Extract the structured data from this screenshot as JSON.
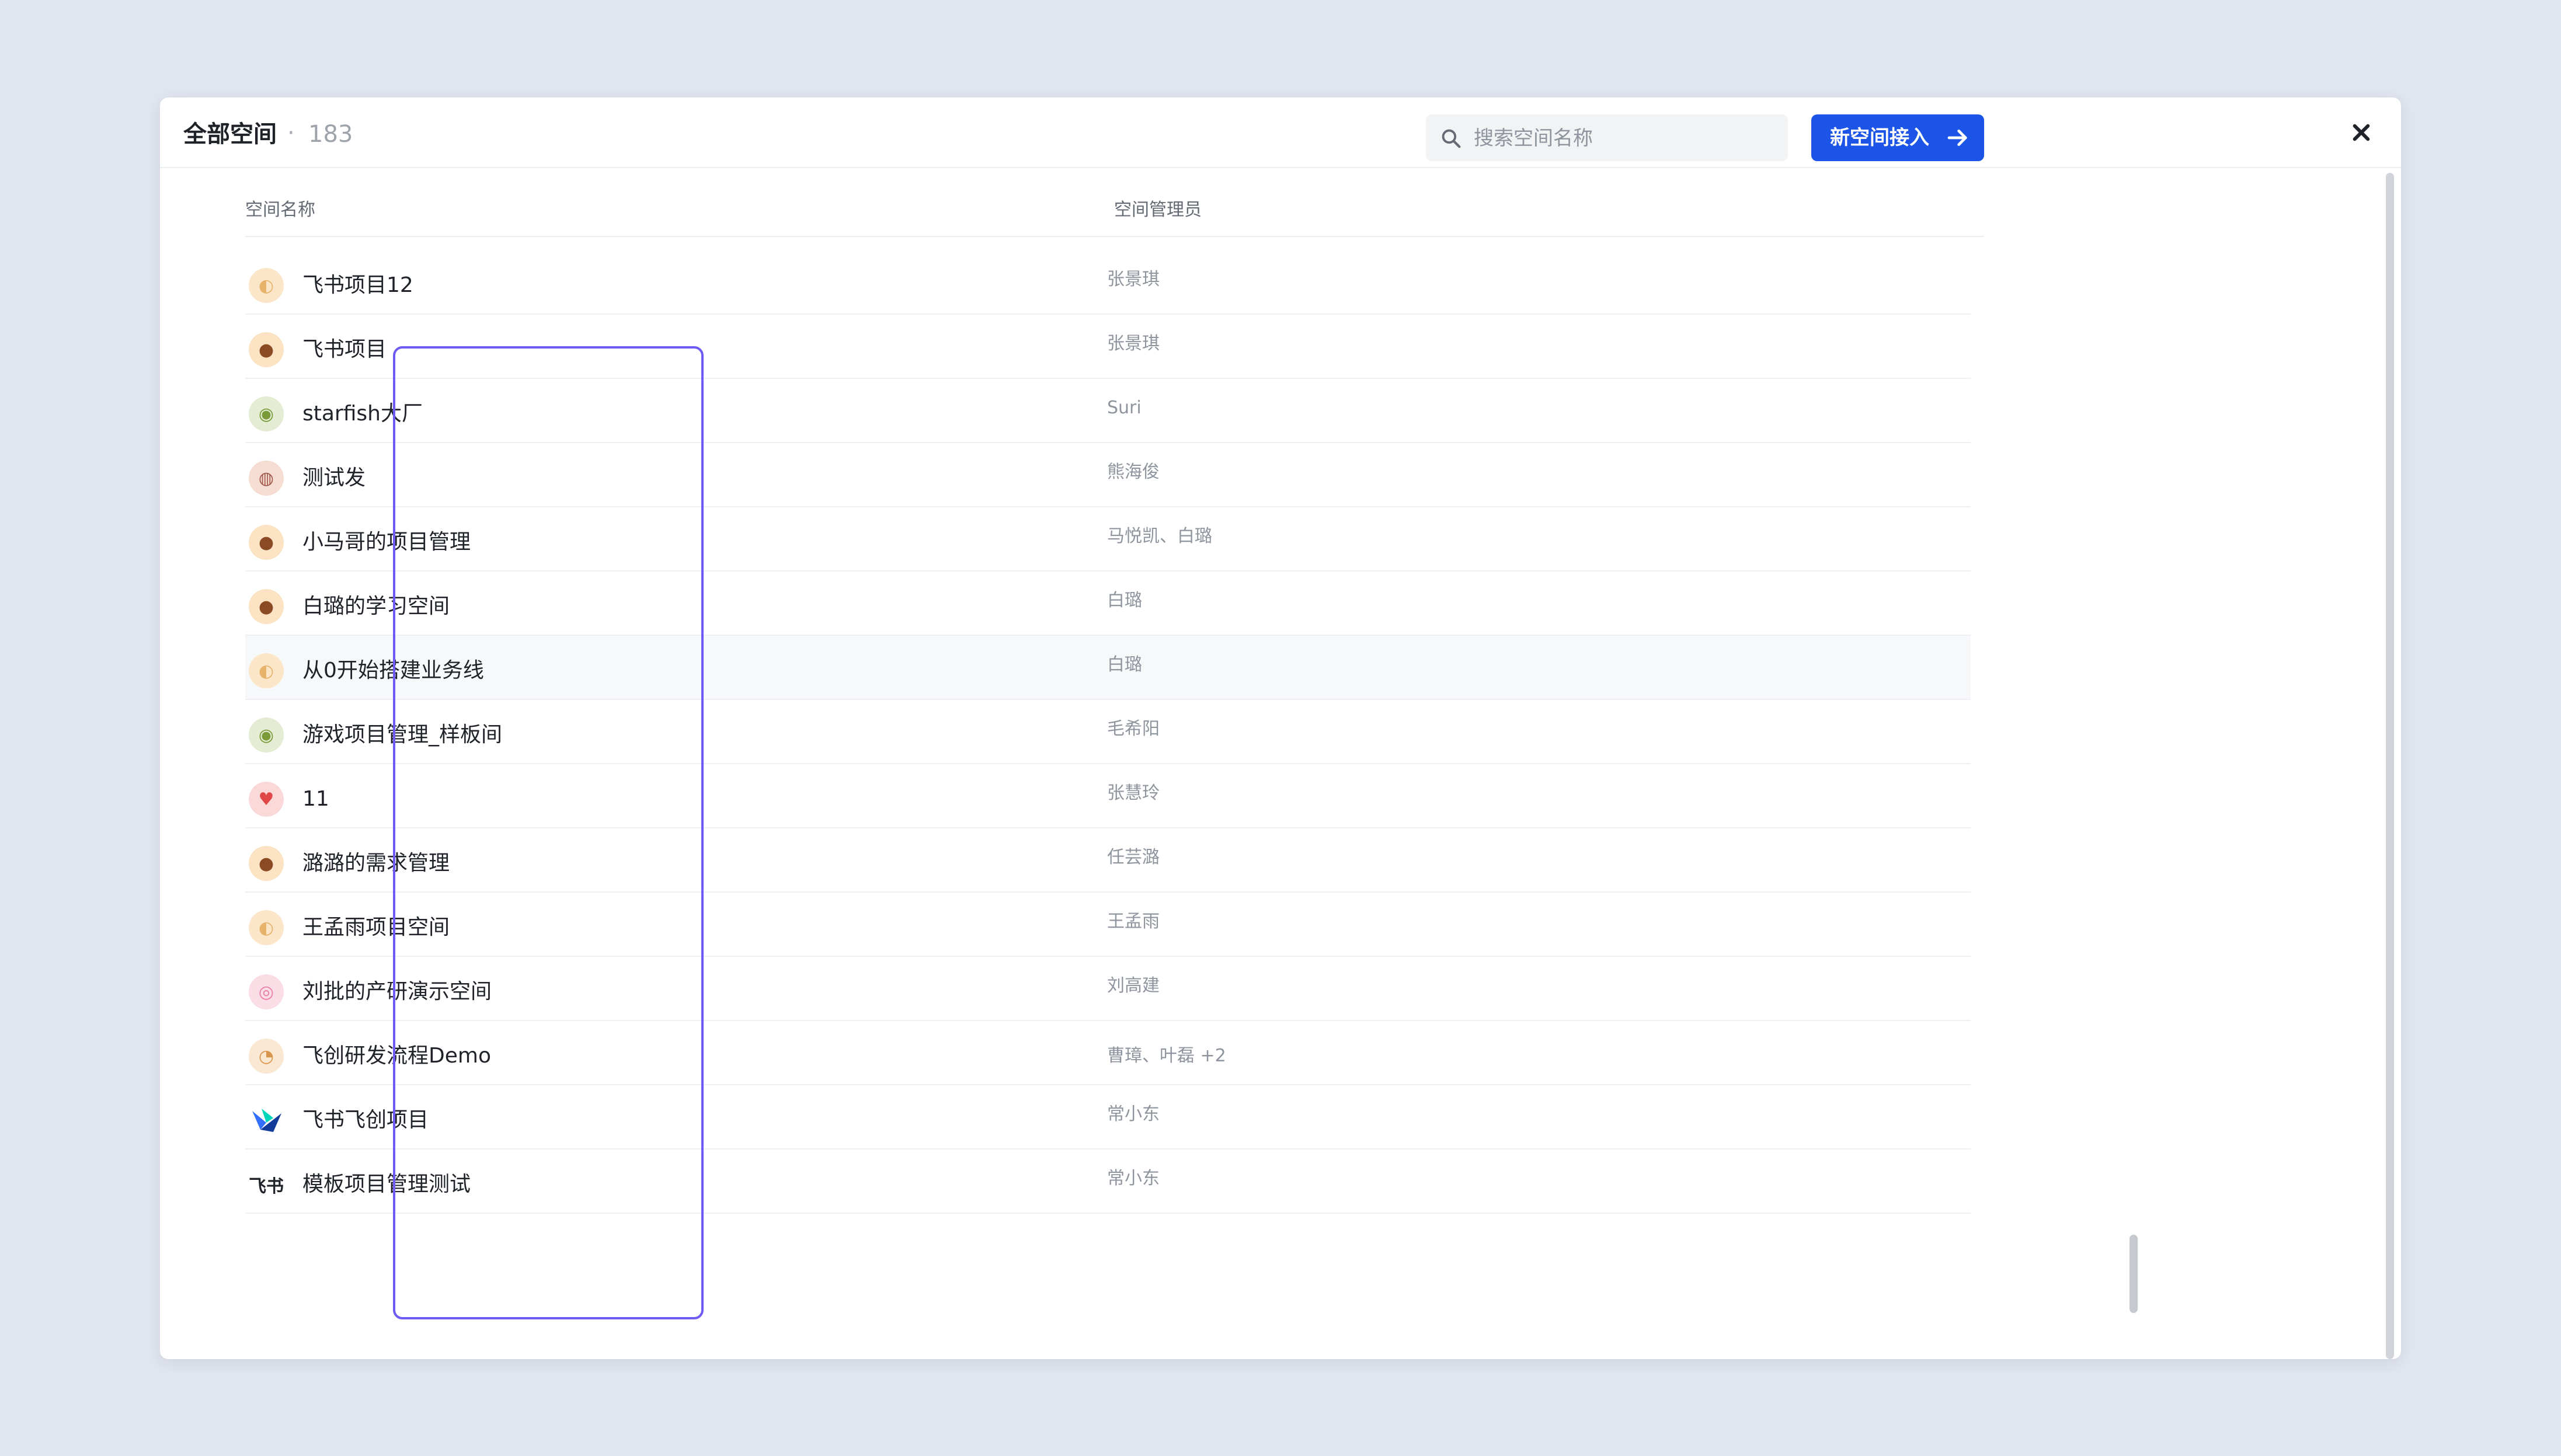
{
  "modal": {
    "title": "全部空间",
    "separator": "·",
    "count": "183",
    "close_icon": "close-icon"
  },
  "toolbar": {
    "search_placeholder": "搜索空间名称",
    "search_value": "",
    "new_button_label": "新空间接入",
    "new_button_icon": "arrow-right-icon"
  },
  "table": {
    "columns": [
      "空间名称",
      "空间管理员"
    ],
    "rows": [
      {
        "name": "飞书项目12",
        "admin": "张景琪",
        "icon": "shell-icon",
        "icon_bg": "#fbe6c9"
      },
      {
        "name": "飞书项目",
        "admin": "张景琪",
        "icon": "pudding-icon",
        "icon_bg": "#fbe3c4"
      },
      {
        "name": "starfish大厂",
        "admin": "Suri",
        "icon": "avocado-icon",
        "icon_bg": "#e4ecd4"
      },
      {
        "name": "测试发",
        "admin": "熊海俊",
        "icon": "bean-icon",
        "icon_bg": "#f5ddd3"
      },
      {
        "name": "小马哥的项目管理",
        "admin": "马悦凯、白璐",
        "icon": "pudding-icon",
        "icon_bg": "#fbe3c4"
      },
      {
        "name": "白璐的学习空间",
        "admin": "白璐",
        "icon": "pudding-icon",
        "icon_bg": "#fbe3c4"
      },
      {
        "name": "从0开始搭建业务线",
        "admin": "白璐",
        "icon": "shell-icon",
        "icon_bg": "#fbe6c9"
      },
      {
        "name": "游戏项目管理_样板间",
        "admin": "毛希阳",
        "icon": "avocado-icon",
        "icon_bg": "#e4ecd4"
      },
      {
        "name": "11",
        "admin": "张慧玲",
        "icon": "strawberry-icon",
        "icon_bg": "#fbd9d9"
      },
      {
        "name": "潞潞的需求管理",
        "admin": "任芸潞",
        "icon": "pudding-icon",
        "icon_bg": "#fbe3c4"
      },
      {
        "name": "王孟雨项目空间",
        "admin": "王孟雨",
        "icon": "shell-icon",
        "icon_bg": "#fbe6c9"
      },
      {
        "name": "刘批的产研演示空间",
        "admin": "刘高建",
        "icon": "donut-icon",
        "icon_bg": "#fbdde6"
      },
      {
        "name": "飞创研发流程Demo",
        "admin": "曹璋、叶磊 +2",
        "icon": "drumstick-icon",
        "icon_bg": "#fbe8d2"
      },
      {
        "name": "飞书飞创项目",
        "admin": "常小东",
        "icon": "feishu-logo-icon",
        "icon_bg": "#ffffff"
      },
      {
        "name": "模板项目管理测试",
        "admin": "常小东",
        "icon": "feishu-text-logo",
        "icon_text": "飞书",
        "icon_bg": "#ffffff"
      }
    ]
  },
  "colors": {
    "accent": "#1d54e8",
    "highlight_border": "#6e5bf4",
    "hover_row": "#f7f8fa"
  }
}
